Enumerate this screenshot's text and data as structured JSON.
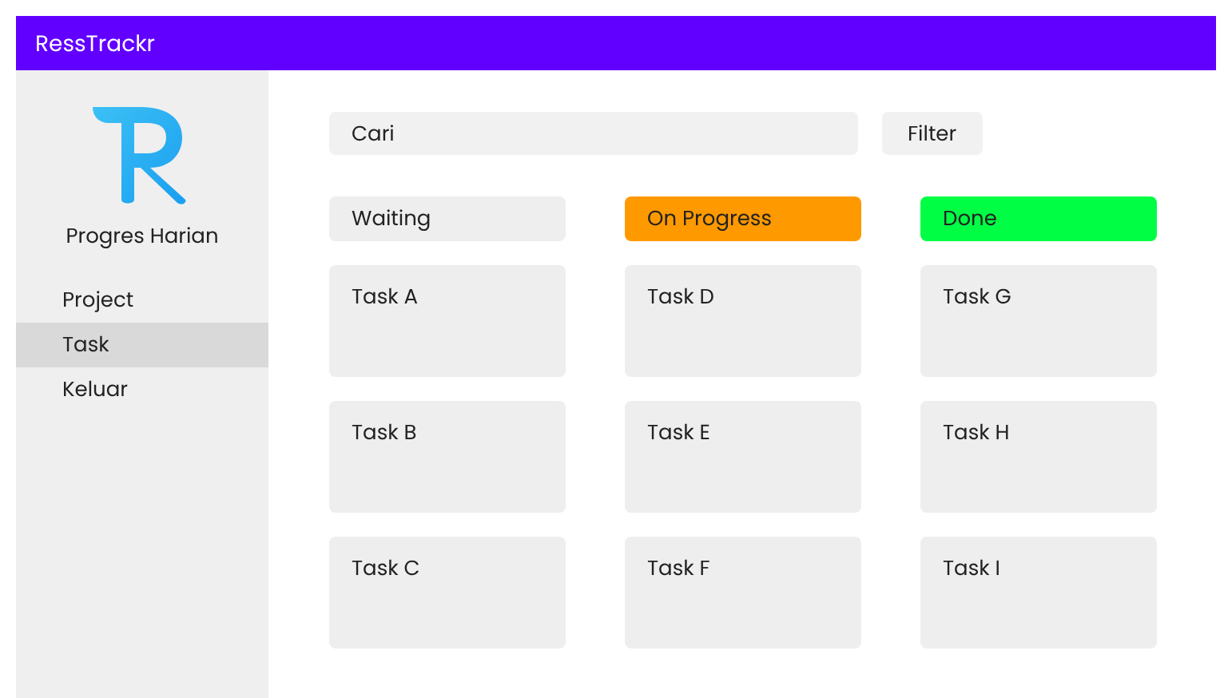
{
  "app_bar": {
    "title": "RessTrackr"
  },
  "sidebar": {
    "subtitle": "Progres Harian",
    "items": [
      {
        "label": "Project",
        "selected": false
      },
      {
        "label": "Task",
        "selected": true
      },
      {
        "label": "Keluar",
        "selected": false
      }
    ]
  },
  "search": {
    "placeholder": "Cari"
  },
  "filter_button": "Filter",
  "columns": [
    {
      "title": "Waiting",
      "color": "#eeeeee",
      "tasks": [
        "Task A",
        "Task B",
        "Task C"
      ]
    },
    {
      "title": "On Progress",
      "color": "#ff9900",
      "tasks": [
        "Task D",
        "Task E",
        "Task F"
      ]
    },
    {
      "title": "Done",
      "color": "#00ff44",
      "tasks": [
        "Task G",
        "Task H",
        "Task I"
      ]
    }
  ]
}
